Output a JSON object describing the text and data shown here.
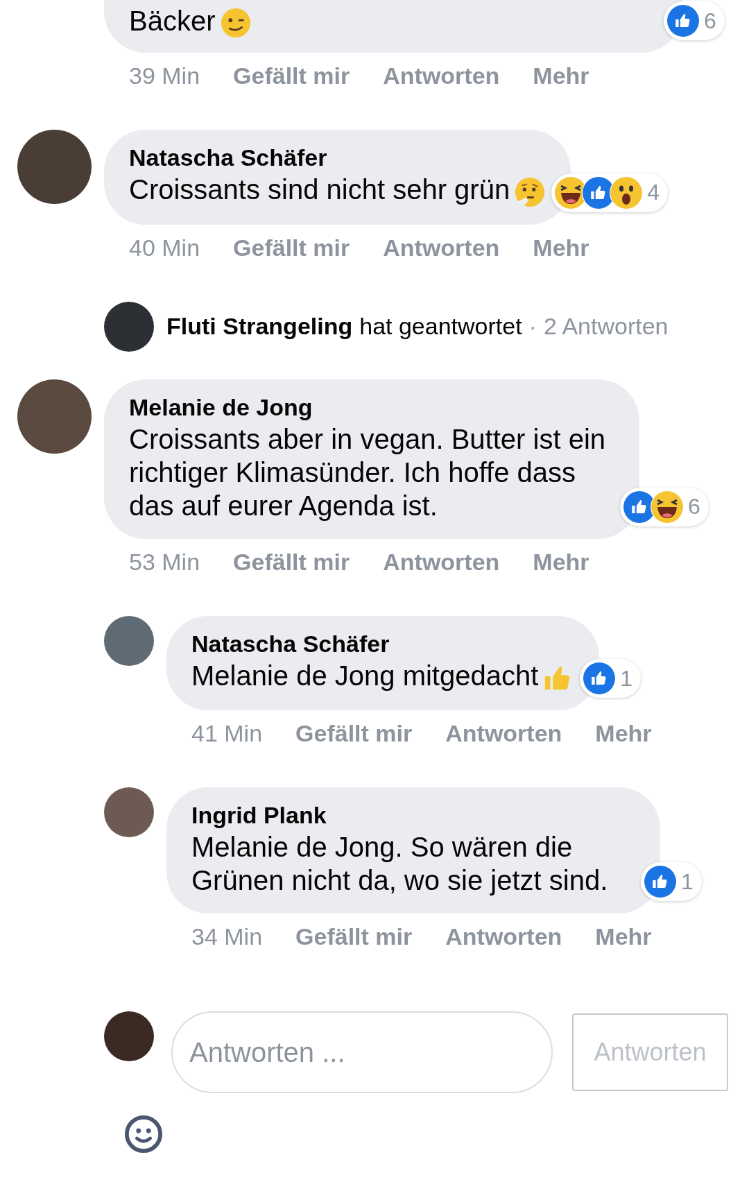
{
  "comments": [
    {
      "kind": "comment",
      "cut": true,
      "text": "Bäcker",
      "emoji": {
        "kind": "wink"
      },
      "time": "39 Min",
      "actions": [
        "Gefällt mir",
        "Antworten",
        "Mehr"
      ],
      "reactions": {
        "items": [
          {
            "kind": "like"
          }
        ],
        "count": "6"
      }
    },
    {
      "kind": "comment",
      "name": "Natascha Schäfer",
      "text": "Croissants sind nicht sehr grün",
      "emoji": {
        "kind": "thinking"
      },
      "time": "40 Min",
      "actions": [
        "Gefällt mir",
        "Antworten",
        "Mehr"
      ],
      "reactions": {
        "items": [
          {
            "kind": "haha"
          },
          {
            "kind": "like"
          },
          {
            "kind": "wow"
          }
        ],
        "count": "4"
      }
    },
    {
      "kind": "summary",
      "name": "Fluti Strangeling",
      "text": "hat geantwortet",
      "separator": "·",
      "count": "2 Antworten"
    },
    {
      "kind": "comment",
      "name": "Melanie de Jong",
      "text": "Croissants aber in vegan. Butter ist ein richtiger Klimasünder. Ich hoffe dass das auf eurer Agenda ist.",
      "time": "53 Min",
      "actions": [
        "Gefällt mir",
        "Antworten",
        "Mehr"
      ],
      "reactions": {
        "items": [
          {
            "kind": "like"
          },
          {
            "kind": "haha"
          }
        ],
        "count": "6"
      },
      "children": [
        {
          "kind": "comment",
          "name": "Natascha Schäfer",
          "text": "Melanie de Jong mitgedacht",
          "emoji": {
            "kind": "thumb"
          },
          "time": "41 Min",
          "actions": [
            "Gefällt mir",
            "Antworten",
            "Mehr"
          ],
          "reactions": {
            "items": [
              {
                "kind": "like"
              }
            ],
            "count": "1"
          }
        },
        {
          "kind": "comment",
          "name": "Ingrid Plank",
          "text": "Melanie de Jong. So wären die Grünen nicht da, wo sie jetzt sind.",
          "time": "34 Min",
          "actions": [
            "Gefällt mir",
            "Antworten",
            "Mehr"
          ],
          "reactions": {
            "items": [
              {
                "kind": "like"
              }
            ],
            "count": "1"
          }
        }
      ]
    }
  ],
  "composer": {
    "placeholder": "Antworten ...",
    "button": "Antworten"
  }
}
